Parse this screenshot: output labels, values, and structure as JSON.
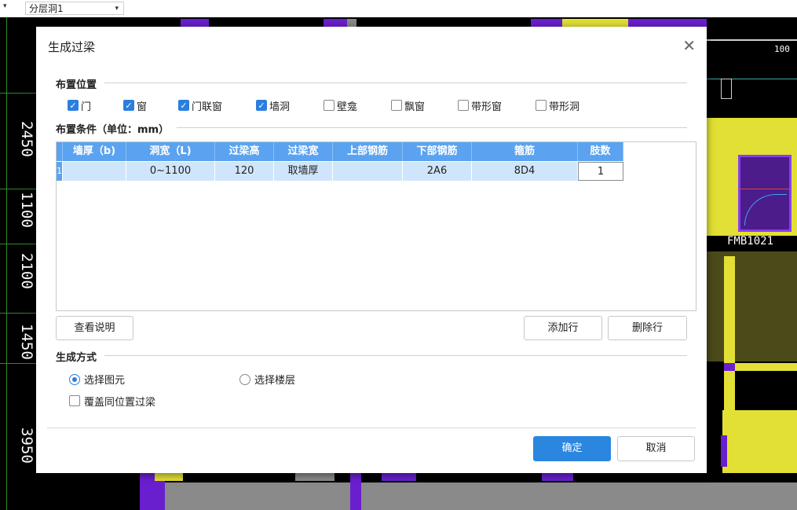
{
  "toolbar": {
    "floor_dropdown_arrow": "▾",
    "layer_dropdown": "分层洞1",
    "layer_dropdown_arrow": "▾"
  },
  "cad": {
    "dims": [
      "2450",
      "1100",
      "2100",
      "1450",
      "3950"
    ],
    "label_fmb": "FMB1021",
    "label_100": "100",
    "colors": {
      "yellow": "#e2e034",
      "purple": "#6a1fcf",
      "gray": "#8a8a8a",
      "olive": "#4b4b1a"
    }
  },
  "dialog": {
    "title": "生成过梁",
    "close_glyph": "✕",
    "placement_section": "布置位置",
    "placement_options": [
      {
        "label": "门",
        "checked": true
      },
      {
        "label": "窗",
        "checked": true
      },
      {
        "label": "门联窗",
        "checked": true
      },
      {
        "label": "墙洞",
        "checked": true
      },
      {
        "label": "壁龛",
        "checked": false
      },
      {
        "label": "飘窗",
        "checked": false
      },
      {
        "label": "带形窗",
        "checked": false
      },
      {
        "label": "带形洞",
        "checked": false
      }
    ],
    "condition_section": "布置条件（单位：mm）",
    "table": {
      "columns": [
        "墙厚（b)",
        "洞宽（L)",
        "过梁高",
        "过梁宽",
        "上部钢筋",
        "下部钢筋",
        "箍筋",
        "肢数"
      ],
      "rows": [
        {
          "index": "1",
          "cells": [
            "",
            "0~1100",
            "120",
            "取墙厚",
            "",
            "2A6",
            "8D4",
            "1"
          ]
        }
      ]
    },
    "view_help_button": "查看说明",
    "add_row_button": "添加行",
    "delete_row_button": "删除行",
    "method_section": "生成方式",
    "method_options": [
      {
        "label": "选择图元",
        "selected": true
      },
      {
        "label": "选择楼层",
        "selected": false
      }
    ],
    "overwrite_checkbox": {
      "label": "覆盖同位置过梁",
      "checked": false
    },
    "ok_button": "确定",
    "cancel_button": "取消"
  }
}
